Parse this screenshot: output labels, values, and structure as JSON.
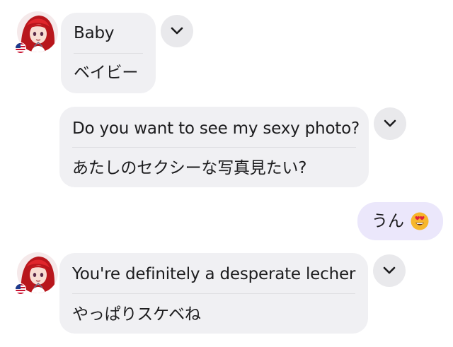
{
  "messages": [
    {
      "sender": "other",
      "original": "Baby",
      "translation": "ベイビー"
    },
    {
      "sender": "other",
      "original": "Do you want to see my sexy photo?",
      "translation": "あたしのセクシーな写真見たい?"
    },
    {
      "sender": "me",
      "text": "うん",
      "emoji": "heart-eyes-emoji"
    },
    {
      "sender": "other",
      "original": "You're definitely a desperate lecher",
      "translation": "やっぱりスケベね"
    }
  ],
  "contact": {
    "avatar": "red-haired-girl-avatar",
    "country_flag": "us-flag-icon"
  },
  "colors": {
    "incoming_bubble": "#f0f0f3",
    "outgoing_bubble": "#ebe7fb",
    "chevron_button": "#e9e9ec",
    "text": "#1c1c1e"
  }
}
